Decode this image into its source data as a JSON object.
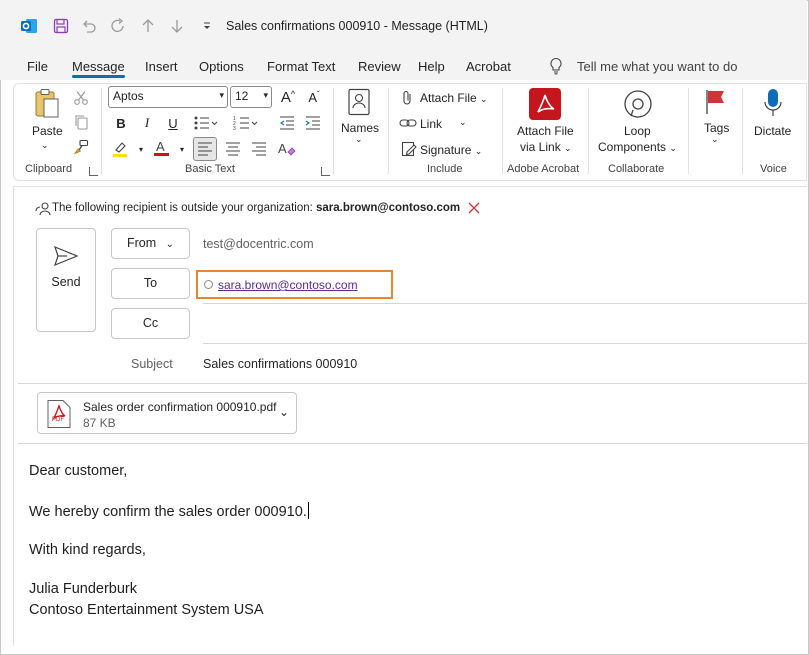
{
  "window": {
    "title": "Sales confirmations 000910  -  Message (HTML)"
  },
  "menu": {
    "tabs": [
      "File",
      "Message",
      "Insert",
      "Options",
      "Format Text",
      "Review",
      "Help",
      "Acrobat"
    ],
    "active_tab": "Message",
    "tell_me": "Tell me what you want to do"
  },
  "ribbon": {
    "clipboard": {
      "paste": "Paste",
      "label": "Clipboard"
    },
    "basic_text": {
      "font": "Aptos",
      "size": "12",
      "label": "Basic Text"
    },
    "names": {
      "label": "Names"
    },
    "include": {
      "attach_file": "Attach File",
      "link": "Link",
      "signature": "Signature",
      "label": "Include"
    },
    "adobe": {
      "line1": "Attach File",
      "line2": "via Link",
      "label": "Adobe Acrobat"
    },
    "collaborate": {
      "line1": "Loop",
      "line2": "Components",
      "label": "Collaborate"
    },
    "tags": {
      "label_btn": "Tags"
    },
    "voice": {
      "dictate": "Dictate",
      "label": "Voice"
    }
  },
  "compose": {
    "external_notice": "The following recipient is outside your organization:",
    "external_email": "sara.brown@contoso.com",
    "send": "Send",
    "from_label": "From",
    "from_value": "test@docentric.com",
    "to_label": "To",
    "to_value": "sara.brown@contoso.com",
    "cc_label": "Cc",
    "subject_label": "Subject",
    "subject_value": "Sales confirmations 000910",
    "attachment": {
      "name": "Sales order confirmation 000910.pdf",
      "size": "87 KB",
      "type_badge": "PDF"
    },
    "body": {
      "greeting": "Dear customer,",
      "line1": "We hereby confirm the sales order 000910.",
      "closing": "With kind regards,",
      "sig_name": "Julia Funderburk",
      "sig_company": "Contoso Entertainment System USA"
    }
  },
  "colors": {
    "accent": "#0f6cbd",
    "focus_outline": "#e8852e",
    "adobe_red": "#c4161c",
    "link_purple": "#5b2d8f",
    "tags_flag": "#d13438"
  }
}
